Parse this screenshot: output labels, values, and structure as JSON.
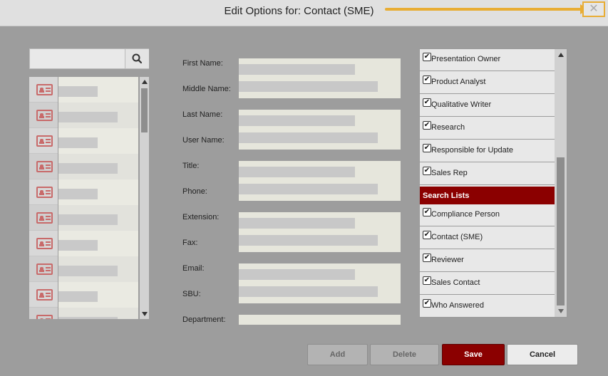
{
  "dialog": {
    "title": "Edit Options for: Contact (SME)",
    "close_label": "✕"
  },
  "search": {
    "placeholder": "",
    "button_icon": "search-icon"
  },
  "contact_list": {
    "icon": "contact-card-icon",
    "row_count": 10
  },
  "form": {
    "labels": [
      "First Name:",
      "Middle Name:",
      "Last Name:",
      "User Name:",
      "Title:",
      "Phone:",
      "Extension:",
      "Fax:",
      "Email:",
      "SBU:",
      "Department:"
    ]
  },
  "roles": {
    "items_top": [
      "Presentation Owner",
      "Product Analyst",
      "Qualitative Writer",
      "Research",
      "Responsible for Update",
      "Sales Rep"
    ],
    "section_header": "Search Lists",
    "items_bottom": [
      "Compliance Person",
      "Contact (SME)",
      "Reviewer",
      "Sales Contact",
      "Who Answered"
    ],
    "checkbox_mark": "✔"
  },
  "buttons": {
    "add": "Add",
    "delete": "Delete",
    "save": "Save",
    "cancel": "Cancel"
  },
  "colors": {
    "accent": "#8b0000",
    "highlight_arrow": "#e8ad35",
    "icon_red": "#c86a6a"
  }
}
